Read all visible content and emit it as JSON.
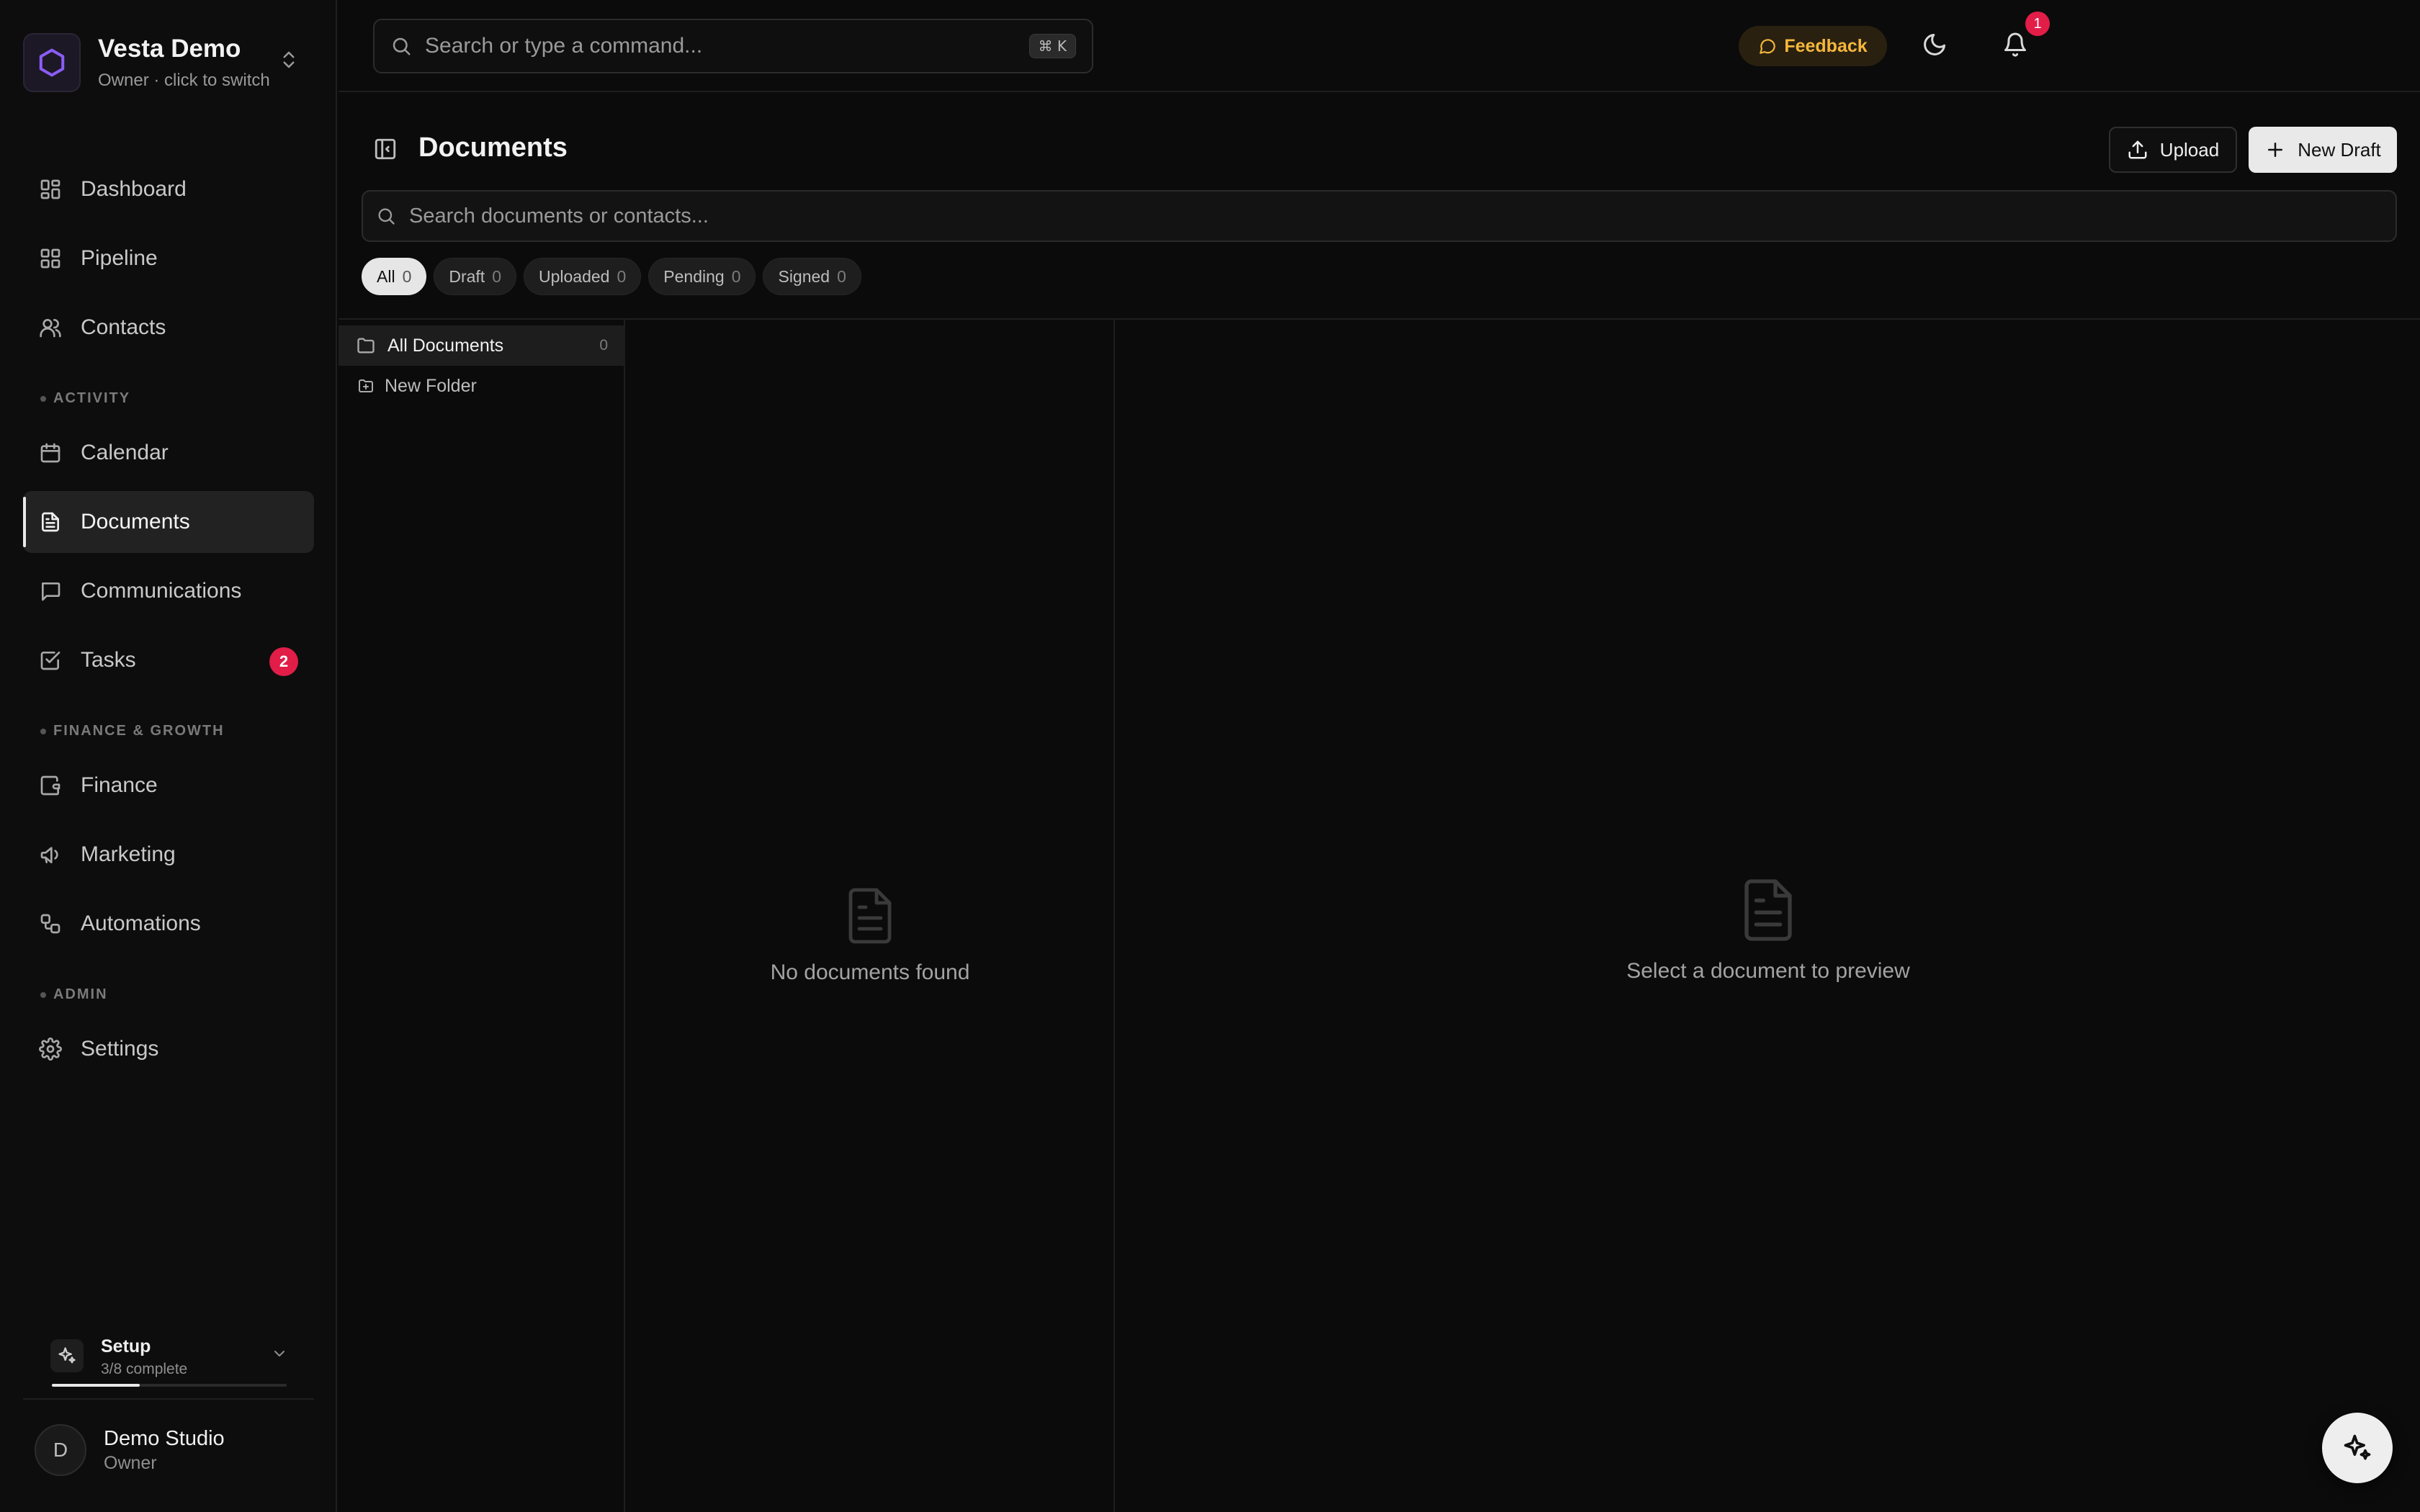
{
  "workspace": {
    "name": "Vesta Demo",
    "subtitle": "Owner · click to switch",
    "logo_color": "#8b5cf6"
  },
  "sidebar": {
    "items": [
      {
        "label": "Dashboard",
        "icon": "dashboard-icon"
      },
      {
        "label": "Pipeline",
        "icon": "pipeline-icon"
      },
      {
        "label": "Contacts",
        "icon": "users-icon"
      }
    ],
    "sections": [
      {
        "label": "ACTIVITY",
        "items": [
          {
            "label": "Calendar",
            "icon": "calendar-icon"
          },
          {
            "label": "Documents",
            "icon": "document-icon",
            "active": true
          },
          {
            "label": "Communications",
            "icon": "message-icon"
          },
          {
            "label": "Tasks",
            "icon": "checkbox-icon",
            "badge": "2"
          }
        ]
      },
      {
        "label": "FINANCE & GROWTH",
        "items": [
          {
            "label": "Finance",
            "icon": "wallet-icon"
          },
          {
            "label": "Marketing",
            "icon": "megaphone-icon"
          },
          {
            "label": "Automations",
            "icon": "workflow-icon"
          }
        ]
      },
      {
        "label": "ADMIN",
        "items": [
          {
            "label": "Settings",
            "icon": "gear-icon"
          }
        ]
      }
    ],
    "setup": {
      "title": "Setup",
      "progress_text": "3/8 complete",
      "progress": 0.375
    },
    "user": {
      "initial": "D",
      "name": "Demo Studio",
      "role": "Owner"
    }
  },
  "topbar": {
    "command_placeholder": "Search or type a command...",
    "shortcut": "⌘ K",
    "feedback_label": "Feedback",
    "notification_count": "1",
    "accent_feedback": "#f5b73b",
    "badge_color": "#e11d48"
  },
  "page": {
    "title": "Documents",
    "upload_label": "Upload",
    "new_draft_label": "New Draft",
    "search_placeholder": "Search documents or contacts...",
    "filters": [
      {
        "label": "All",
        "count": "0",
        "active": true
      },
      {
        "label": "Draft",
        "count": "0"
      },
      {
        "label": "Uploaded",
        "count": "0"
      },
      {
        "label": "Pending",
        "count": "0"
      },
      {
        "label": "Signed",
        "count": "0"
      }
    ],
    "folders": [
      {
        "label": "All Documents",
        "count": "0",
        "active": true
      },
      {
        "label": "New Folder"
      }
    ],
    "empty_list_text": "No documents found",
    "empty_preview_text": "Select a document to preview"
  }
}
